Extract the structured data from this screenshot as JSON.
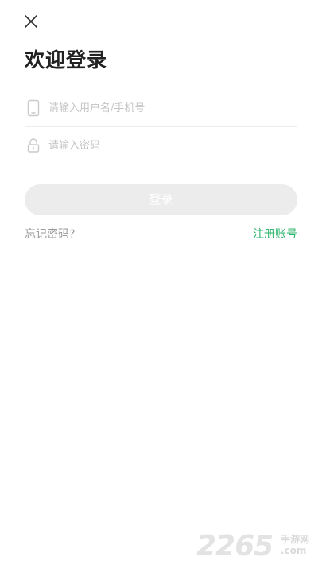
{
  "header": {
    "close_icon": "close-icon"
  },
  "title": "欢迎登录",
  "form": {
    "phone": {
      "icon": "phone-icon",
      "placeholder": "请输入用户名/手机号",
      "value": ""
    },
    "password": {
      "icon": "lock-icon",
      "placeholder": "请输入密码",
      "value": ""
    },
    "login_label": "登录"
  },
  "links": {
    "forgot_password": "忘记密码?",
    "register": "注册账号"
  },
  "watermark": {
    "number": "2265",
    "cn": "手游网",
    "domain": ".com"
  },
  "colors": {
    "accent": "#2bb46b",
    "button_disabled": "#ececec",
    "title": "#222222",
    "placeholder": "#c4c4c4"
  }
}
